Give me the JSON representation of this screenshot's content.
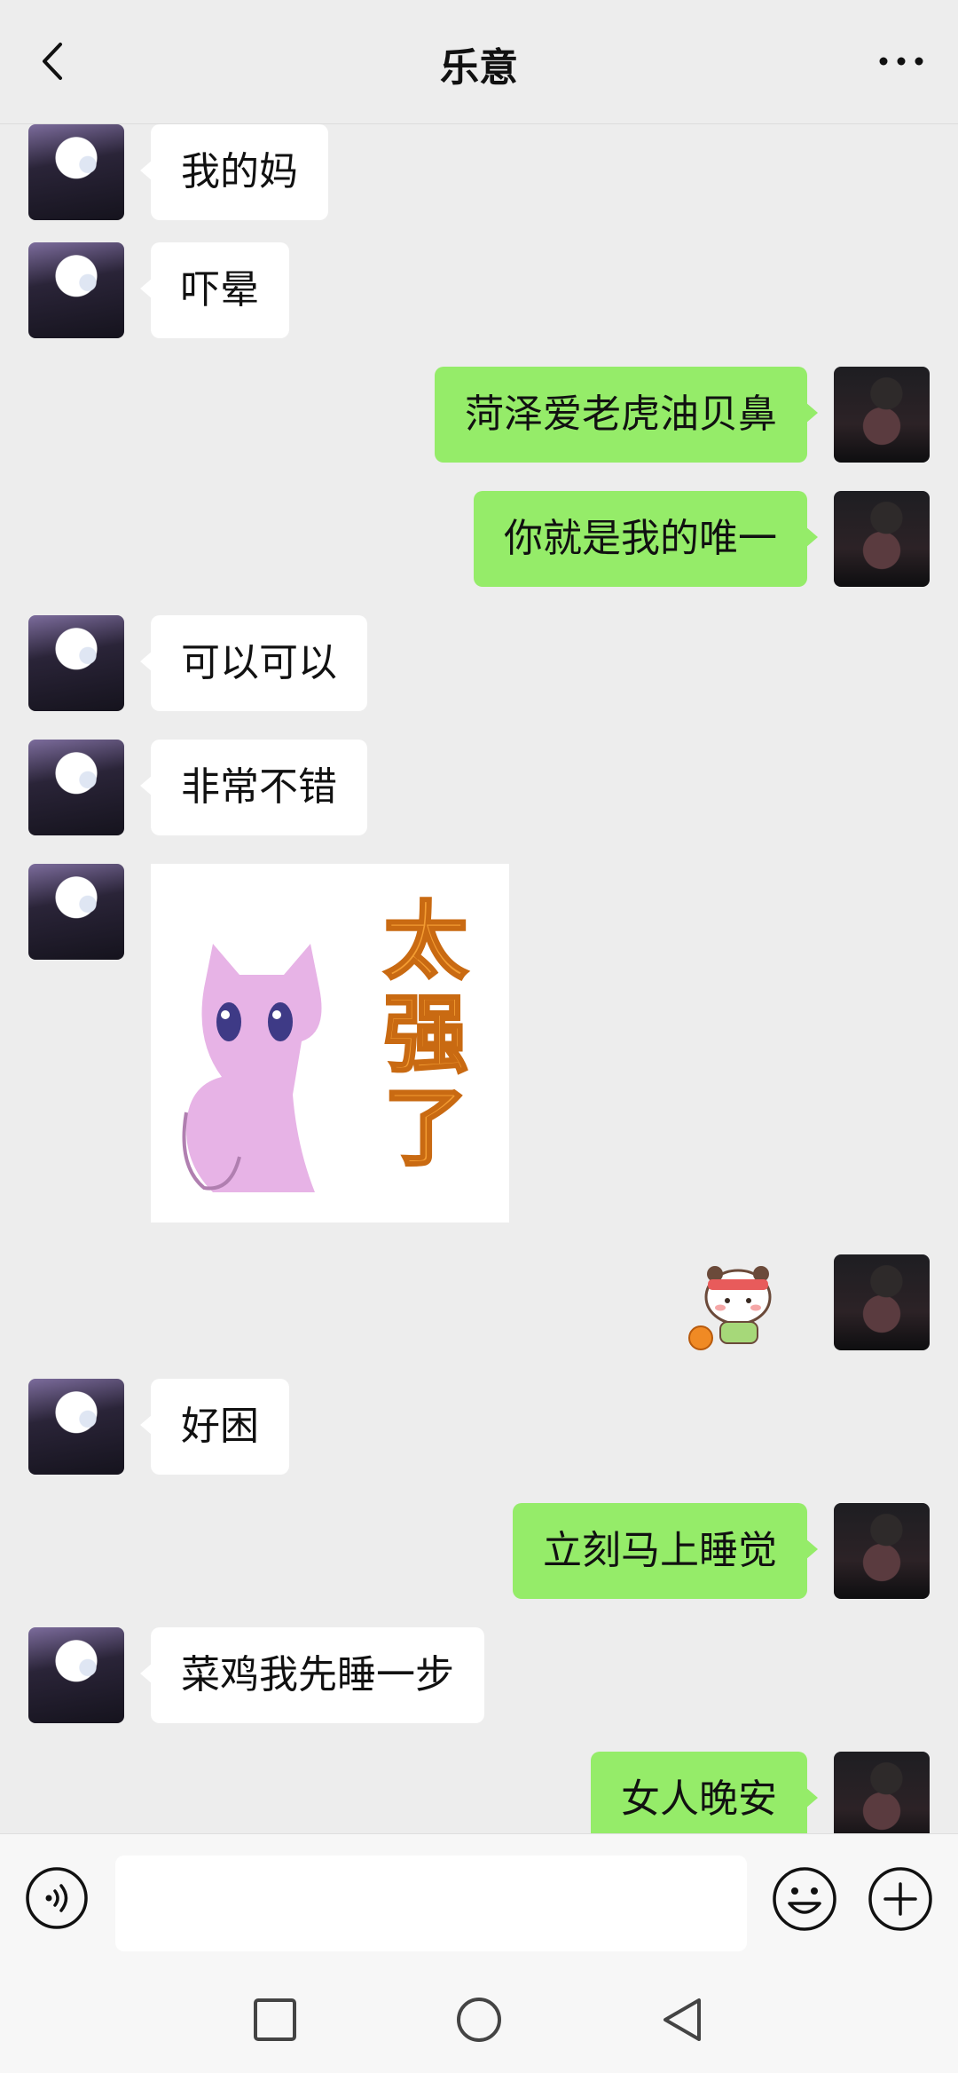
{
  "header": {
    "title": "乐意",
    "back_icon": "chevron-left-icon",
    "more_icon": "more-dots-icon"
  },
  "colors": {
    "background": "#ededed",
    "bubble_self": "#95ec69",
    "bubble_other": "#ffffff"
  },
  "messages": [
    {
      "side": "left",
      "type": "text",
      "text": "我的妈"
    },
    {
      "side": "left",
      "type": "text",
      "text": "吓晕"
    },
    {
      "side": "right",
      "type": "text",
      "text": "菏泽爱老虎油贝鼻"
    },
    {
      "side": "right",
      "type": "text",
      "text": "你就是我的唯一"
    },
    {
      "side": "left",
      "type": "text",
      "text": "可以可以"
    },
    {
      "side": "left",
      "type": "text",
      "text": "非常不错"
    },
    {
      "side": "left",
      "type": "sticker",
      "sticker_text": "太强了"
    },
    {
      "side": "right",
      "type": "sticker",
      "sticker_name": "panda-basketball-sticker"
    },
    {
      "side": "left",
      "type": "text",
      "text": "好困"
    },
    {
      "side": "right",
      "type": "text",
      "text": "立刻马上睡觉"
    },
    {
      "side": "left",
      "type": "text",
      "text": "菜鸡我先睡一步"
    },
    {
      "side": "right",
      "type": "text",
      "text": "女人晚安"
    }
  ],
  "input_bar": {
    "voice_icon": "voice-icon",
    "text_value": "",
    "emoji_icon": "emoji-icon",
    "plus_icon": "plus-icon"
  },
  "navbar": {
    "icons": [
      "square-icon",
      "circle-icon",
      "triangle-back-icon"
    ]
  }
}
